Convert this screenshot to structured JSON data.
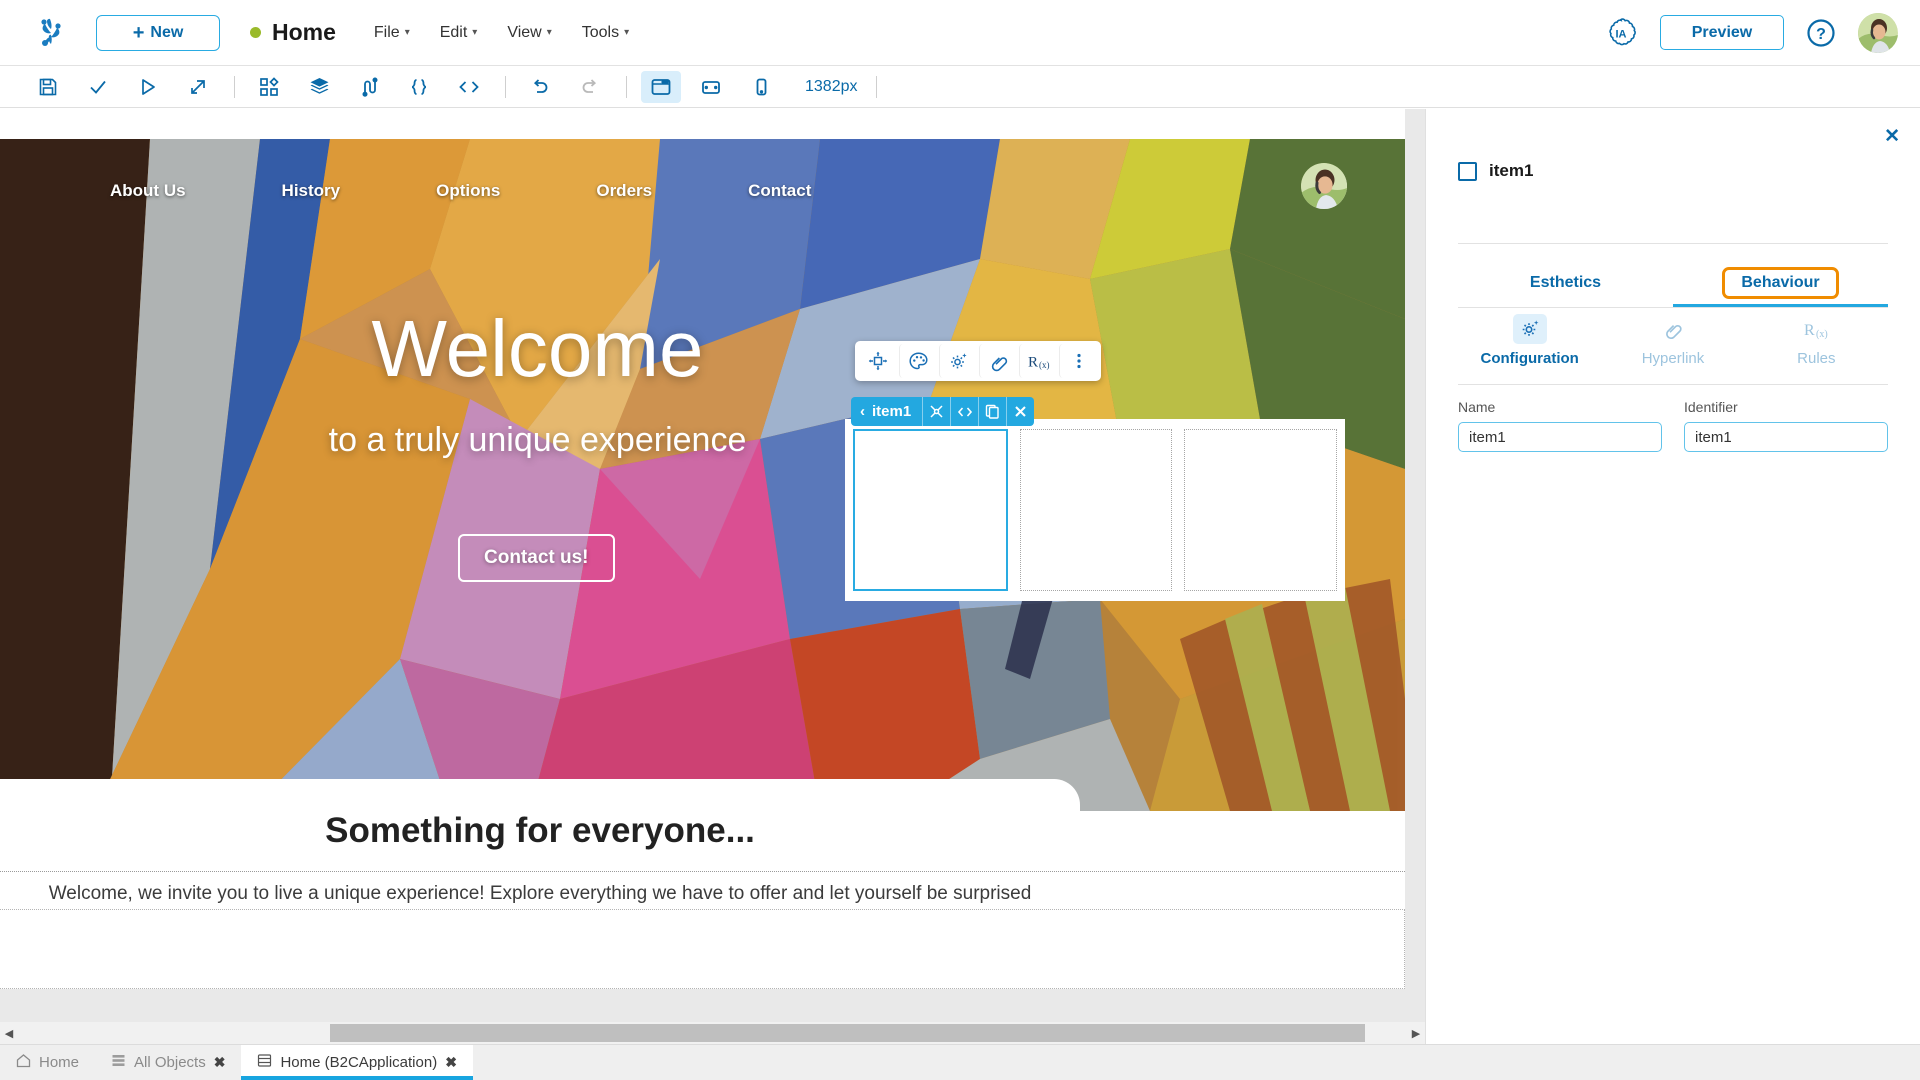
{
  "header": {
    "logo_icon": "frog-logo-icon",
    "new_button": "New",
    "page_title": "Home",
    "status_dot_color": "#9aba2a",
    "menus": [
      "File",
      "Edit",
      "View",
      "Tools"
    ],
    "ia_label": "IA",
    "preview_button": "Preview",
    "help_icon": "question-circle-icon",
    "avatar_icon": "user-avatar"
  },
  "toolbar": {
    "icons": [
      "save-icon",
      "check-icon",
      "play-icon",
      "export-icon",
      "grid-icon",
      "layers-icon",
      "flow-icon",
      "braces-icon",
      "code-icon",
      "undo-icon",
      "redo-icon",
      "desktop-icon",
      "tablet-icon",
      "mobile-icon"
    ],
    "viewport_size": "1382px",
    "active_device": "desktop-icon"
  },
  "canvas": {
    "site_nav": [
      "About Us",
      "History",
      "Options",
      "Orders",
      "Contact"
    ],
    "hero_title": "Welcome",
    "hero_subtitle": "to a truly unique experience",
    "hero_cta": "Contact us!",
    "section_title": "Something for everyone...",
    "section_text": "Welcome, we invite you to live a unique experience! Explore everything we have to offer and let yourself be surprised by the diversity of options at your disposal. We are excited to have you here and hope your time in our space is as special as you imagined.",
    "float_toolbar_icons": [
      "move-icon",
      "palette-icon",
      "gear-sparkle-icon",
      "link-icon",
      "rules-rx-icon",
      "kebab-menu-icon"
    ],
    "selection_badge": {
      "label": "item1",
      "back_icon": "chevron-left-icon",
      "actions": [
        "cut-icon",
        "code-icon",
        "copy-icon",
        "close-icon"
      ]
    },
    "columns": 3,
    "selected_column": 1
  },
  "panel": {
    "close_icon": "close-icon",
    "object_name": "item1",
    "tabs": [
      {
        "label": "Esthetics",
        "selected": false,
        "highlighted": false
      },
      {
        "label": "Behaviour",
        "selected": true,
        "highlighted": true
      }
    ],
    "subtabs": [
      {
        "label": "Configuration",
        "icon": "gear-sparkle-icon",
        "selected": true
      },
      {
        "label": "Hyperlink",
        "icon": "link-icon",
        "selected": false
      },
      {
        "label": "Rules",
        "icon": "rules-rx-icon",
        "selected": false
      }
    ],
    "fields": [
      {
        "label": "Name",
        "value": "item1"
      },
      {
        "label": "Identifier",
        "value": "item1"
      }
    ],
    "accent_color": "#23a8e0",
    "highlight_color": "#f08c00"
  },
  "tabbar": {
    "tabs": [
      {
        "label": "Home",
        "icon": "home-icon",
        "active": false,
        "closable": false
      },
      {
        "label": "All Objects",
        "icon": "list-icon",
        "active": false,
        "closable": true
      },
      {
        "label": "Home (B2CApplication)",
        "icon": "window-icon",
        "active": true,
        "closable": true
      }
    ],
    "close_label": "✖"
  }
}
